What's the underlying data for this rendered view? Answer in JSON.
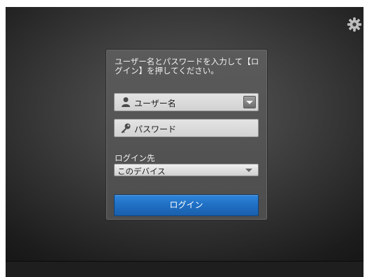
{
  "login": {
    "instruction": "ユーザー名とパスワードを入力して【ログイン】を押してください。",
    "username_placeholder": "ユーザー名",
    "password_placeholder": "パスワード",
    "destination_label": "ログイン先",
    "destination_value": "このデバイス",
    "login_button": "ログイン"
  },
  "icons": {
    "settings": "gear-icon",
    "user": "user-icon",
    "key": "key-icon",
    "username_dropdown": "chevron-down-icon",
    "destination_dropdown": "chevron-down-icon"
  },
  "colors": {
    "background": "#2a2a2a",
    "panel": "#555555",
    "accent": "#1f6fc4"
  }
}
